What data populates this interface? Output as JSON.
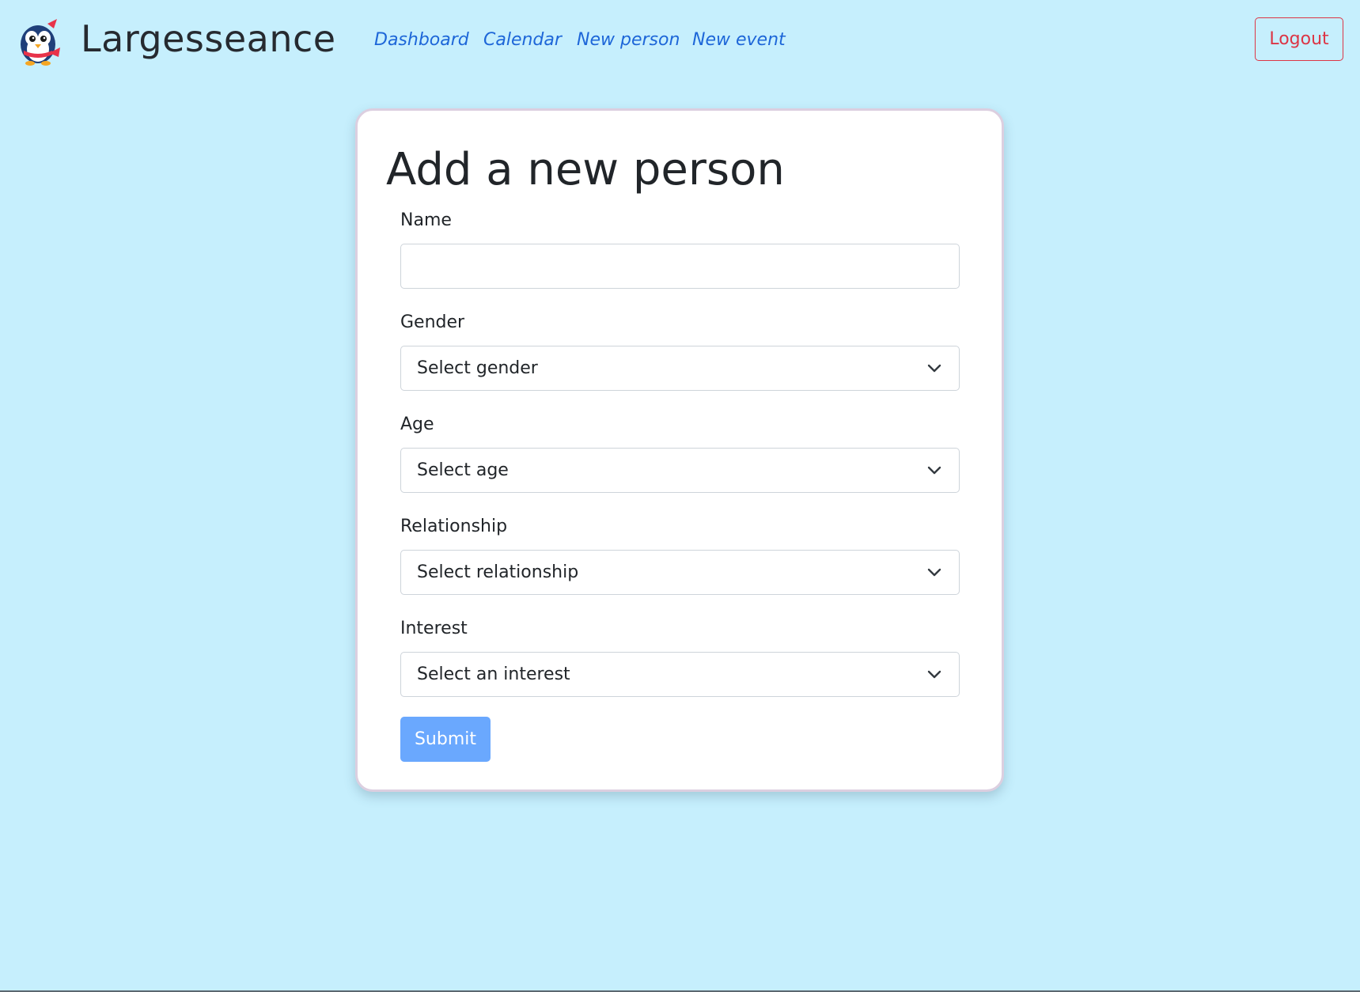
{
  "app": {
    "brand_name": "Largesseance"
  },
  "nav": {
    "links": [
      {
        "label": "Dashboard"
      },
      {
        "label": "Calendar"
      },
      {
        "label": "New person"
      },
      {
        "label": "New event"
      }
    ],
    "logout_label": "Logout"
  },
  "form": {
    "title": "Add a new person",
    "name": {
      "label": "Name",
      "value": ""
    },
    "gender": {
      "label": "Gender",
      "selected": "Select gender"
    },
    "age": {
      "label": "Age",
      "selected": "Select age"
    },
    "relationship": {
      "label": "Relationship",
      "selected": "Select relationship"
    },
    "interest": {
      "label": "Interest",
      "selected": "Select an interest"
    },
    "submit_label": "Submit"
  },
  "colors": {
    "background": "#c6effd",
    "link": "#1d66d8",
    "logout": "#dc3545",
    "submit": "#6aa8fe"
  },
  "icons": {
    "logo": "penguin-logo-icon",
    "select_arrow": "chevron-down-icon"
  }
}
